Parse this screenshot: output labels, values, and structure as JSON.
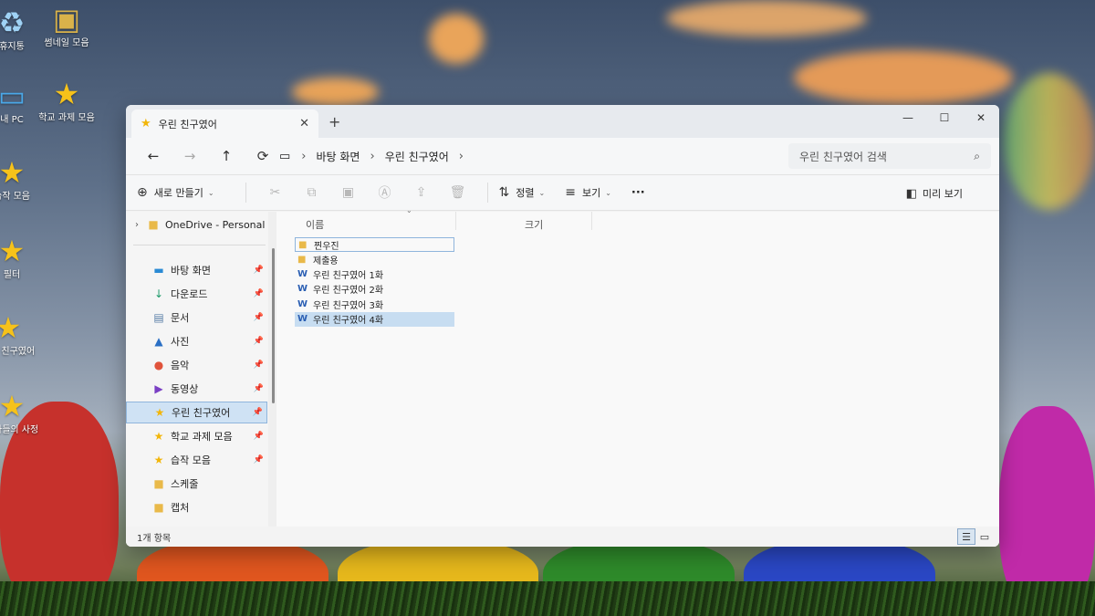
{
  "desktop": {
    "icons": [
      {
        "label": "휴지통",
        "glyph": "♻"
      },
      {
        "label": "썸네일 모음",
        "glyph": "▣"
      },
      {
        "label": "내 PC",
        "glyph": "▭"
      },
      {
        "label": "학교 과제 모음",
        "glyph": "★"
      },
      {
        "label": "습작 모음",
        "glyph": "★"
      },
      {
        "label": "필터",
        "glyph": "★"
      },
      {
        "label": "우린 친구였어",
        "glyph": "★"
      },
      {
        "label": "왕자들의 사정",
        "glyph": "★"
      }
    ]
  },
  "window": {
    "tab_title": "우린 친구였어",
    "new_tab": "+",
    "controls": {
      "minimize": "—",
      "maximize": "☐",
      "close": "✕"
    }
  },
  "navbar": {
    "back": "←",
    "forward": "→",
    "up": "↑",
    "refresh": "⟳",
    "breadcrumb": [
      "바탕 화면",
      "우린 친구였어"
    ],
    "search_placeholder": "우린 친구였어 검색"
  },
  "toolbar": {
    "new_label": "새로 만들기",
    "sort_label": "정렬",
    "view_label": "보기",
    "more": "···",
    "preview_label": "미리 보기"
  },
  "sidebar": {
    "onedrive": "OneDrive - Personal",
    "items": [
      {
        "label": "바탕 화면",
        "icon": "desktop-icon",
        "glyph": "▬",
        "color": "#2a8ad4",
        "pinned": true
      },
      {
        "label": "다운로드",
        "icon": "download-icon",
        "glyph": "↓",
        "color": "#1e9a6a",
        "pinned": true
      },
      {
        "label": "문서",
        "icon": "document-icon",
        "glyph": "▤",
        "color": "#5a7fa8",
        "pinned": true
      },
      {
        "label": "사진",
        "icon": "pictures-icon",
        "glyph": "▲",
        "color": "#2a6fc4",
        "pinned": true
      },
      {
        "label": "음악",
        "icon": "music-icon",
        "glyph": "●",
        "color": "#e0533b",
        "pinned": true
      },
      {
        "label": "동영상",
        "icon": "video-icon",
        "glyph": "▶",
        "color": "#7a3fc4",
        "pinned": true
      },
      {
        "label": "우린 친구였어",
        "icon": "star-icon",
        "glyph": "★",
        "color": "#f2b60a",
        "pinned": true,
        "selected": true
      },
      {
        "label": "학교 과제 모음",
        "icon": "star-icon",
        "glyph": "★",
        "color": "#f2b60a",
        "pinned": true
      },
      {
        "label": "습작 모음",
        "icon": "star-icon",
        "glyph": "★",
        "color": "#f2b60a",
        "pinned": true
      },
      {
        "label": "스케줄",
        "icon": "folder-icon",
        "glyph": "■",
        "color": "#e9b949",
        "pinned": false
      },
      {
        "label": "캡처",
        "icon": "folder-icon",
        "glyph": "■",
        "color": "#e9b949",
        "pinned": false
      }
    ]
  },
  "files": {
    "columns": [
      "이름",
      "크기"
    ],
    "rows": [
      {
        "name": "찐우진",
        "type": "folder"
      },
      {
        "name": "제출용",
        "type": "folder"
      },
      {
        "name": "우린 친구였어 1화",
        "type": "doc"
      },
      {
        "name": "우린 친구였어 2화",
        "type": "doc"
      },
      {
        "name": "우린 친구였어 3화",
        "type": "doc"
      },
      {
        "name": "우린 친구였어 4화",
        "type": "doc",
        "selected": true
      }
    ]
  },
  "status": {
    "count": "1개 항목"
  }
}
